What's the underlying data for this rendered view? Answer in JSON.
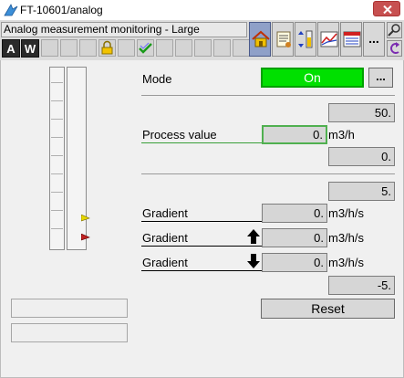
{
  "window": {
    "title": "FT-10601/analog"
  },
  "header": {
    "label": "Analog measurement monitoring - Large"
  },
  "mode_buttons": {
    "a": "A",
    "w": "W"
  },
  "toolbar": {
    "more_label": "..."
  },
  "mode": {
    "label": "Mode",
    "value": "On",
    "more_label": "...",
    "on_color": "#00e000"
  },
  "process": {
    "high_limit": "50.",
    "label": "Process value",
    "value": "0.",
    "unit": "m3/h",
    "low_limit": "0."
  },
  "gradient": {
    "top_value": "5.",
    "rows": [
      {
        "label": "Gradient",
        "value": "0.",
        "unit": "m3/h/s",
        "arrow": "none"
      },
      {
        "label": "Gradient",
        "value": "0.",
        "unit": "m3/h/s",
        "arrow": "up-arrow-icon"
      },
      {
        "label": "Gradient",
        "value": "0.",
        "unit": "m3/h/s",
        "arrow": "down-arrow-icon"
      }
    ],
    "bottom_value": "-5."
  },
  "reset": {
    "label": "Reset"
  },
  "colors": {
    "limit_marker_yellow": "#e6d800",
    "limit_marker_red": "#c02020",
    "active_tab": "#8fa0c8"
  }
}
